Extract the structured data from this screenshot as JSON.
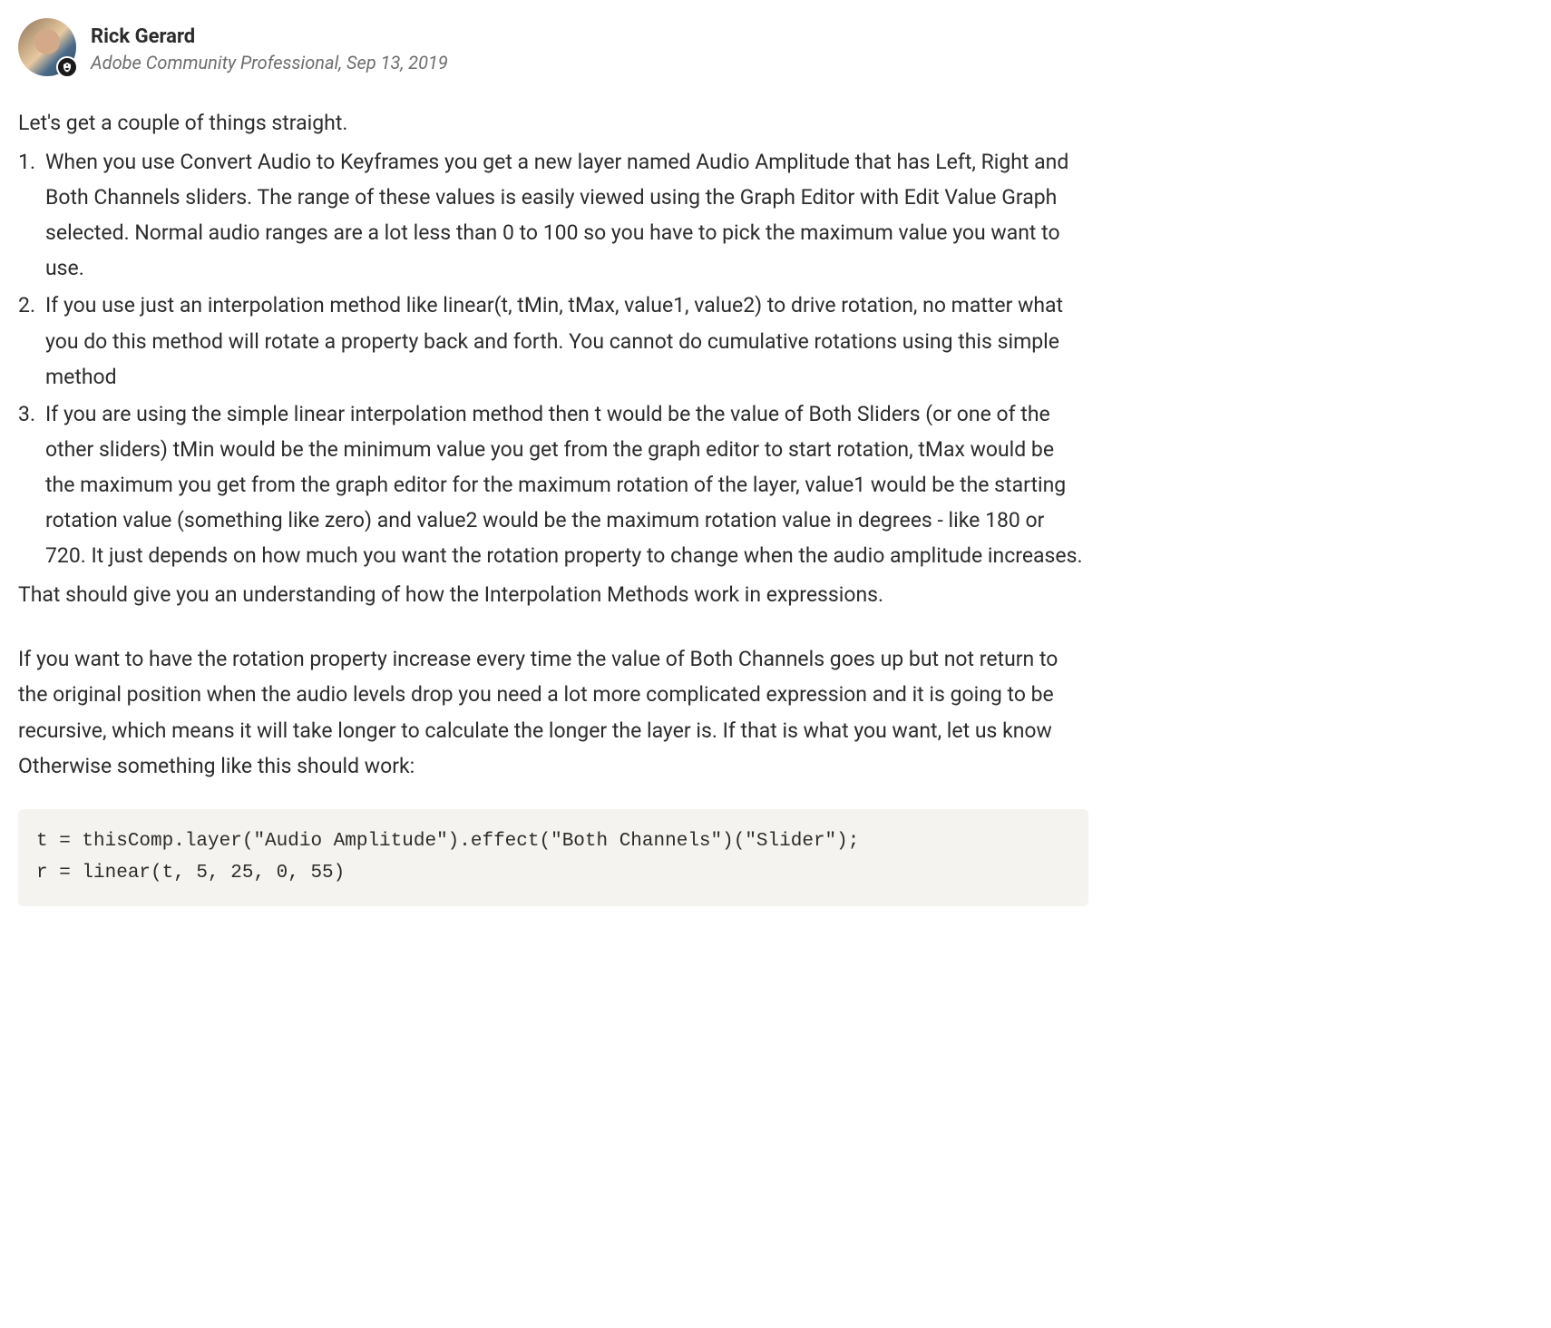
{
  "author": {
    "name": "Rick Gerard",
    "role": "Adobe Community Professional",
    "date": "Sep 13, 2019"
  },
  "content": {
    "intro": "Let's get a couple of things straight.",
    "list_items": [
      "When you use Convert Audio to Keyframes you get a new layer named Audio Amplitude that has Left, Right and Both Channels sliders. The range of these values is easily viewed using the Graph Editor with Edit Value Graph selected. Normal audio ranges are a lot less than 0 to 100 so you have to pick the maximum value you want to use.",
      "If you use just an interpolation method like linear(t, tMin, tMax, value1, value2) to drive rotation, no matter what you do this method will rotate a property back and forth. You cannot do cumulative rotations using this simple method",
      "If you are using the simple linear interpolation method then t would be the value of Both Sliders (or one of the other sliders) tMin would be the minimum value you get from the graph editor to start rotation, tMax would be the maximum you get from the graph editor for the maximum rotation of the layer, value1 would be the starting rotation value (something like zero) and value2 would be the maximum rotation value in degrees - like 180 or 720. It just depends on how much you want the rotation property to change when the audio amplitude increases."
    ],
    "followup": "That should give you an understanding of how the Interpolation Methods work in expressions.",
    "paragraph": "If you want to have the rotation property increase every time the value of Both Channels goes up but not return to the original position when the audio levels drop you need a lot more complicated expression and it is going to be recursive, which means it will take longer to calculate the longer the layer is. If that is what you want, let us know Otherwise something like this should work:",
    "code": "t = thisComp.layer(\"Audio Amplitude\").effect(\"Both Channels\")(\"Slider\");\nr = linear(t, 5, 25, 0, 55)"
  }
}
